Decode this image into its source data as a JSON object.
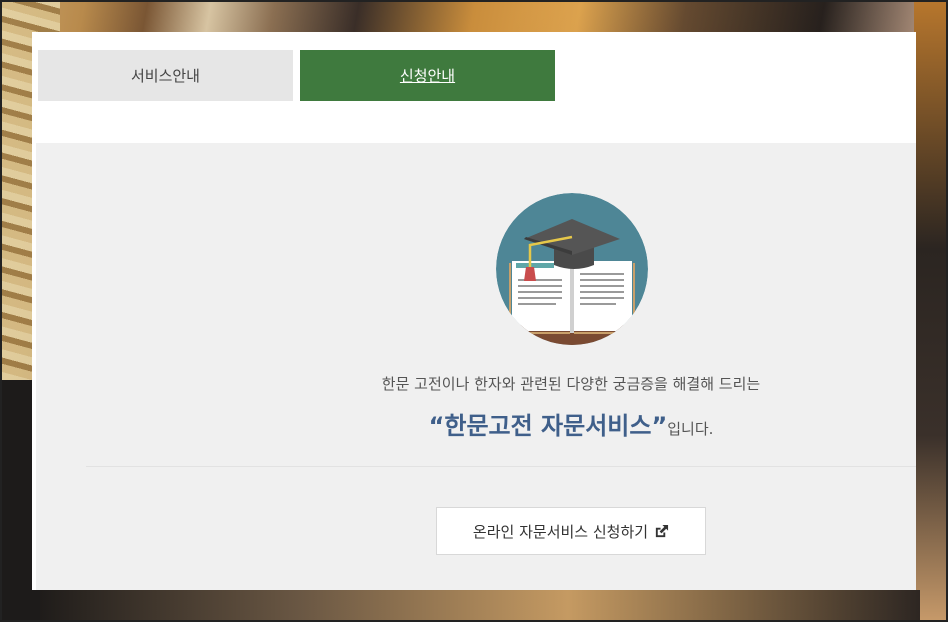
{
  "tabs": [
    {
      "label": "서비스안내",
      "active": false
    },
    {
      "label": "신청안내",
      "active": true
    }
  ],
  "intro_text": "한문 고전이나 한자와 관련된 다양한 궁금증을 해결해 드리는",
  "headline": {
    "emphasis": "“한문고전 자문서비스”",
    "suffix": "입니다."
  },
  "apply_button": {
    "label": "온라인 자문서비스 신청하기",
    "icon": "external-link-icon"
  },
  "colors": {
    "active_tab": "#3f7a3e",
    "inactive_tab": "#e6e6e6",
    "headline_accent": "#3f5f8a",
    "content_bg": "#f0f0f0"
  }
}
